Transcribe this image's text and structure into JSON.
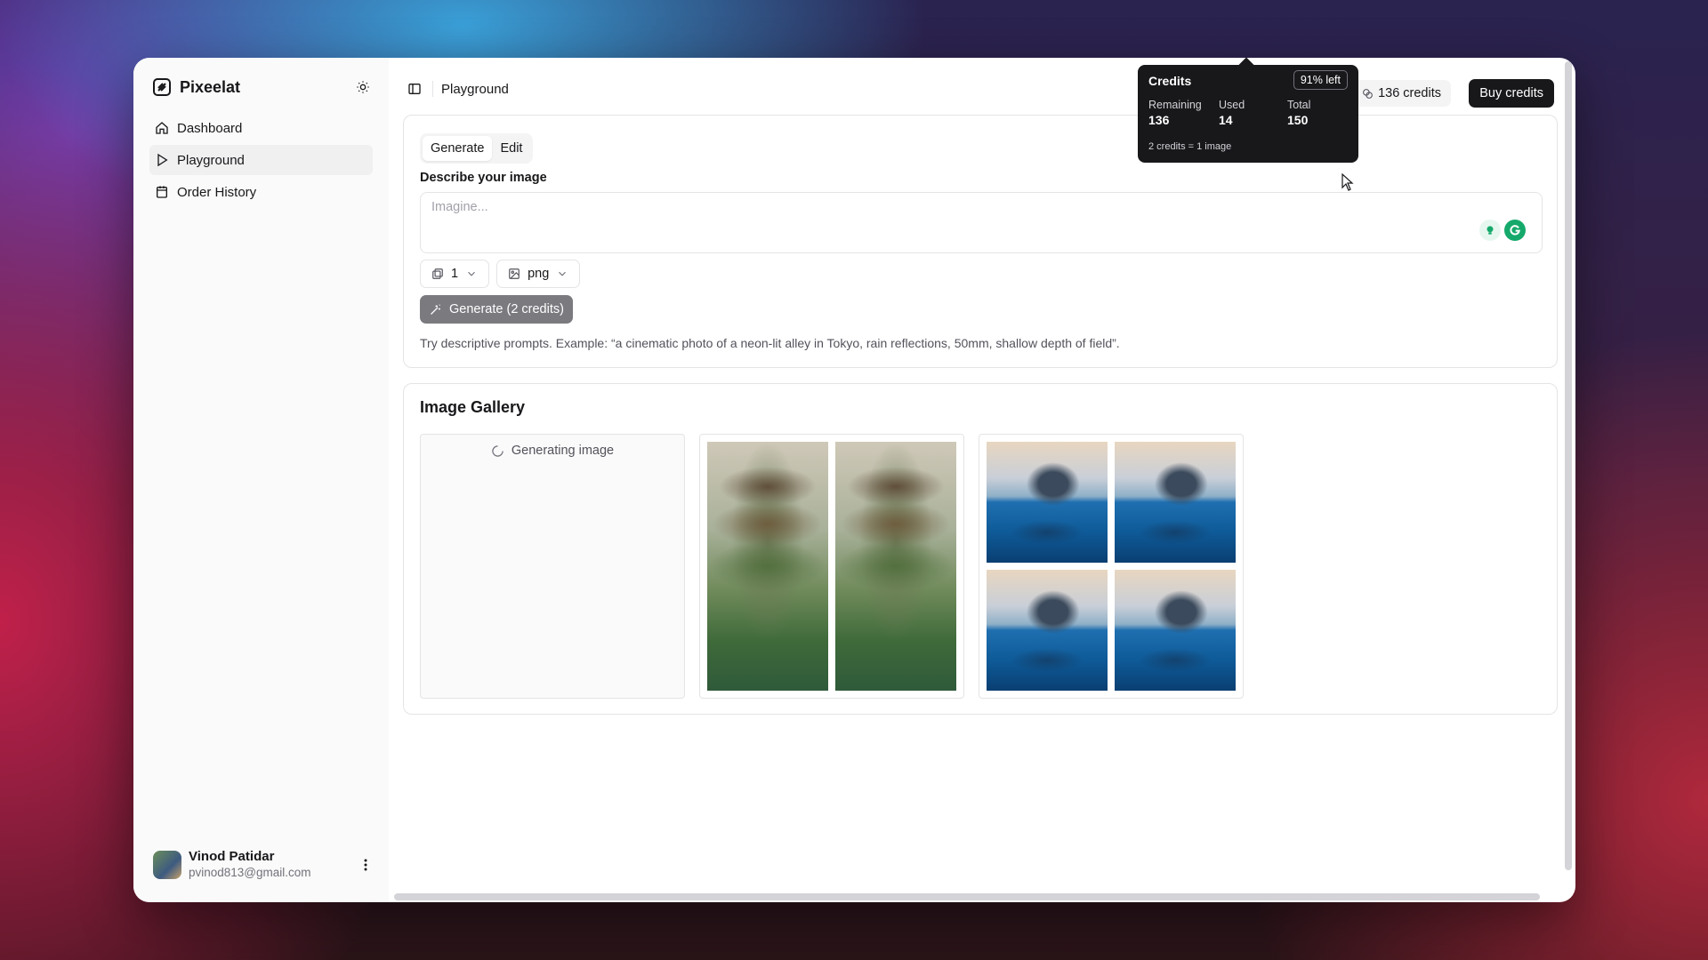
{
  "app": {
    "name": "Pixeelat"
  },
  "sidebar": {
    "items": [
      {
        "label": "Dashboard",
        "icon": "home-icon"
      },
      {
        "label": "Playground",
        "icon": "play-icon"
      },
      {
        "label": "Order History",
        "icon": "calendar-icon"
      }
    ],
    "active": "Playground"
  },
  "user": {
    "name": "Vinod Patidar",
    "email": "pvinod813@gmail.com"
  },
  "header": {
    "breadcrumb": "Playground",
    "credits_label": "136 credits",
    "buy_label": "Buy credits"
  },
  "generate": {
    "tabs": [
      "Generate",
      "Edit"
    ],
    "active_tab": "Generate",
    "field_label": "Describe your image",
    "prompt_placeholder": "Imagine...",
    "count_value": "1",
    "format_value": "png",
    "generate_button": "Generate (2 credits)",
    "hint": "Try descriptive prompts. Example: “a cinematic photo of a neon-lit alley in Tokyo, rain reflections, 50mm, shallow depth of field”."
  },
  "gallery": {
    "title": "Image Gallery",
    "loading_text": "Generating image"
  },
  "credits_popover": {
    "title": "Credits",
    "badge": "91% left",
    "remaining_label": "Remaining",
    "remaining_value": "136",
    "used_label": "Used",
    "used_value": "14",
    "total_label": "Total",
    "total_value": "150",
    "footnote": "2 credits = 1 image"
  },
  "colors": {
    "primary": "#18181b",
    "muted": "#71717a",
    "accent_button": "#7a7a7f"
  }
}
